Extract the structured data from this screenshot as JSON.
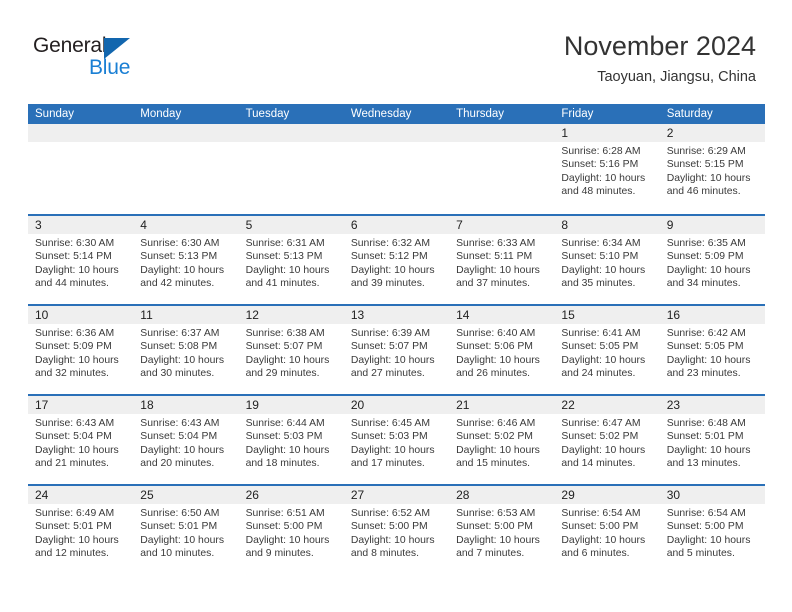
{
  "brand": {
    "logo_text_1": "General",
    "logo_text_2": "Blue",
    "logo_icon": "triangle-icon",
    "color_dark": "#231f20",
    "color_blue": "#1a7fd4",
    "color_triangle": "#1266ae"
  },
  "header": {
    "month_title": "November 2024",
    "location": "Taoyuan, Jiangsu, China"
  },
  "theme": {
    "header_blue": "#2a70b8",
    "daynum_band": "#efefef",
    "text": "#3a3a3a"
  },
  "calendar": {
    "weekdays": [
      "Sunday",
      "Monday",
      "Tuesday",
      "Wednesday",
      "Thursday",
      "Friday",
      "Saturday"
    ],
    "weeks": [
      [
        {
          "day": "",
          "empty": true
        },
        {
          "day": "",
          "empty": true
        },
        {
          "day": "",
          "empty": true
        },
        {
          "day": "",
          "empty": true
        },
        {
          "day": "",
          "empty": true
        },
        {
          "day": "1",
          "sunrise": "Sunrise: 6:28 AM",
          "sunset": "Sunset: 5:16 PM",
          "daylight": "Daylight: 10 hours and 48 minutes."
        },
        {
          "day": "2",
          "sunrise": "Sunrise: 6:29 AM",
          "sunset": "Sunset: 5:15 PM",
          "daylight": "Daylight: 10 hours and 46 minutes."
        }
      ],
      [
        {
          "day": "3",
          "sunrise": "Sunrise: 6:30 AM",
          "sunset": "Sunset: 5:14 PM",
          "daylight": "Daylight: 10 hours and 44 minutes."
        },
        {
          "day": "4",
          "sunrise": "Sunrise: 6:30 AM",
          "sunset": "Sunset: 5:13 PM",
          "daylight": "Daylight: 10 hours and 42 minutes."
        },
        {
          "day": "5",
          "sunrise": "Sunrise: 6:31 AM",
          "sunset": "Sunset: 5:13 PM",
          "daylight": "Daylight: 10 hours and 41 minutes."
        },
        {
          "day": "6",
          "sunrise": "Sunrise: 6:32 AM",
          "sunset": "Sunset: 5:12 PM",
          "daylight": "Daylight: 10 hours and 39 minutes."
        },
        {
          "day": "7",
          "sunrise": "Sunrise: 6:33 AM",
          "sunset": "Sunset: 5:11 PM",
          "daylight": "Daylight: 10 hours and 37 minutes."
        },
        {
          "day": "8",
          "sunrise": "Sunrise: 6:34 AM",
          "sunset": "Sunset: 5:10 PM",
          "daylight": "Daylight: 10 hours and 35 minutes."
        },
        {
          "day": "9",
          "sunrise": "Sunrise: 6:35 AM",
          "sunset": "Sunset: 5:09 PM",
          "daylight": "Daylight: 10 hours and 34 minutes."
        }
      ],
      [
        {
          "day": "10",
          "sunrise": "Sunrise: 6:36 AM",
          "sunset": "Sunset: 5:09 PM",
          "daylight": "Daylight: 10 hours and 32 minutes."
        },
        {
          "day": "11",
          "sunrise": "Sunrise: 6:37 AM",
          "sunset": "Sunset: 5:08 PM",
          "daylight": "Daylight: 10 hours and 30 minutes."
        },
        {
          "day": "12",
          "sunrise": "Sunrise: 6:38 AM",
          "sunset": "Sunset: 5:07 PM",
          "daylight": "Daylight: 10 hours and 29 minutes."
        },
        {
          "day": "13",
          "sunrise": "Sunrise: 6:39 AM",
          "sunset": "Sunset: 5:07 PM",
          "daylight": "Daylight: 10 hours and 27 minutes."
        },
        {
          "day": "14",
          "sunrise": "Sunrise: 6:40 AM",
          "sunset": "Sunset: 5:06 PM",
          "daylight": "Daylight: 10 hours and 26 minutes."
        },
        {
          "day": "15",
          "sunrise": "Sunrise: 6:41 AM",
          "sunset": "Sunset: 5:05 PM",
          "daylight": "Daylight: 10 hours and 24 minutes."
        },
        {
          "day": "16",
          "sunrise": "Sunrise: 6:42 AM",
          "sunset": "Sunset: 5:05 PM",
          "daylight": "Daylight: 10 hours and 23 minutes."
        }
      ],
      [
        {
          "day": "17",
          "sunrise": "Sunrise: 6:43 AM",
          "sunset": "Sunset: 5:04 PM",
          "daylight": "Daylight: 10 hours and 21 minutes."
        },
        {
          "day": "18",
          "sunrise": "Sunrise: 6:43 AM",
          "sunset": "Sunset: 5:04 PM",
          "daylight": "Daylight: 10 hours and 20 minutes."
        },
        {
          "day": "19",
          "sunrise": "Sunrise: 6:44 AM",
          "sunset": "Sunset: 5:03 PM",
          "daylight": "Daylight: 10 hours and 18 minutes."
        },
        {
          "day": "20",
          "sunrise": "Sunrise: 6:45 AM",
          "sunset": "Sunset: 5:03 PM",
          "daylight": "Daylight: 10 hours and 17 minutes."
        },
        {
          "day": "21",
          "sunrise": "Sunrise: 6:46 AM",
          "sunset": "Sunset: 5:02 PM",
          "daylight": "Daylight: 10 hours and 15 minutes."
        },
        {
          "day": "22",
          "sunrise": "Sunrise: 6:47 AM",
          "sunset": "Sunset: 5:02 PM",
          "daylight": "Daylight: 10 hours and 14 minutes."
        },
        {
          "day": "23",
          "sunrise": "Sunrise: 6:48 AM",
          "sunset": "Sunset: 5:01 PM",
          "daylight": "Daylight: 10 hours and 13 minutes."
        }
      ],
      [
        {
          "day": "24",
          "sunrise": "Sunrise: 6:49 AM",
          "sunset": "Sunset: 5:01 PM",
          "daylight": "Daylight: 10 hours and 12 minutes."
        },
        {
          "day": "25",
          "sunrise": "Sunrise: 6:50 AM",
          "sunset": "Sunset: 5:01 PM",
          "daylight": "Daylight: 10 hours and 10 minutes."
        },
        {
          "day": "26",
          "sunrise": "Sunrise: 6:51 AM",
          "sunset": "Sunset: 5:00 PM",
          "daylight": "Daylight: 10 hours and 9 minutes."
        },
        {
          "day": "27",
          "sunrise": "Sunrise: 6:52 AM",
          "sunset": "Sunset: 5:00 PM",
          "daylight": "Daylight: 10 hours and 8 minutes."
        },
        {
          "day": "28",
          "sunrise": "Sunrise: 6:53 AM",
          "sunset": "Sunset: 5:00 PM",
          "daylight": "Daylight: 10 hours and 7 minutes."
        },
        {
          "day": "29",
          "sunrise": "Sunrise: 6:54 AM",
          "sunset": "Sunset: 5:00 PM",
          "daylight": "Daylight: 10 hours and 6 minutes."
        },
        {
          "day": "30",
          "sunrise": "Sunrise: 6:54 AM",
          "sunset": "Sunset: 5:00 PM",
          "daylight": "Daylight: 10 hours and 5 minutes."
        }
      ]
    ]
  }
}
